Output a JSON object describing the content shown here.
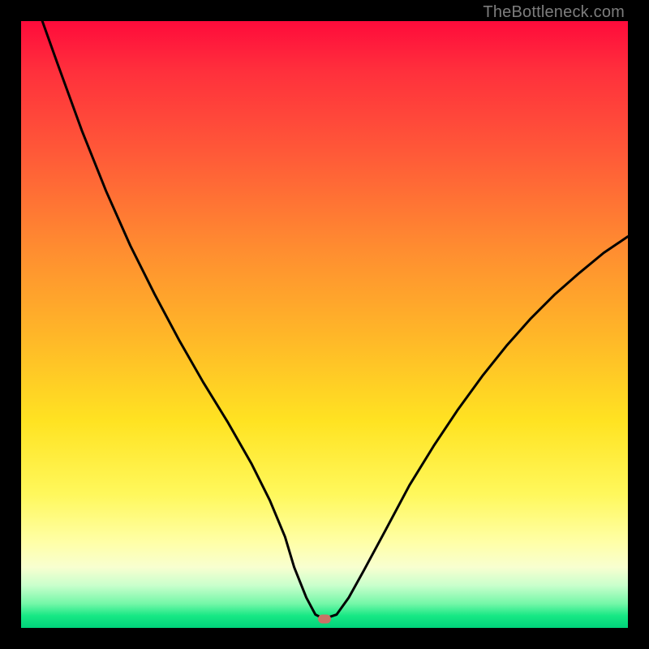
{
  "watermark": "TheBottleneck.com",
  "chart_data": {
    "type": "line",
    "title": "",
    "xlabel": "",
    "ylabel": "",
    "xlim": [
      0,
      100
    ],
    "ylim": [
      0,
      100
    ],
    "series": [
      {
        "name": "bottleneck-curve",
        "x": [
          3.5,
          6,
          10,
          14,
          18,
          22,
          26,
          30,
          34,
          38,
          41,
          43.5,
          45,
          47,
          48.5,
          49.5,
          50.5,
          52,
          54,
          56.5,
          60,
          64,
          68,
          72,
          76,
          80,
          84,
          88,
          92,
          96,
          100
        ],
        "y": [
          100,
          93,
          82,
          72,
          63,
          55,
          47.5,
          40.5,
          34,
          27,
          21,
          15,
          10,
          5,
          2.2,
          1.7,
          1.7,
          2.2,
          5,
          9.5,
          16,
          23.5,
          30,
          36,
          41.5,
          46.5,
          51,
          55,
          58.5,
          61.8,
          64.5
        ]
      }
    ],
    "marker": {
      "x": 50,
      "y": 1.5
    },
    "gradient_stops": [
      {
        "pos": 0,
        "color": "#ff0b3b"
      },
      {
        "pos": 22,
        "color": "#ff5a38"
      },
      {
        "pos": 52,
        "color": "#ffb728"
      },
      {
        "pos": 78,
        "color": "#fff85c"
      },
      {
        "pos": 93,
        "color": "#c9ffcc"
      },
      {
        "pos": 100,
        "color": "#00d27a"
      }
    ]
  }
}
